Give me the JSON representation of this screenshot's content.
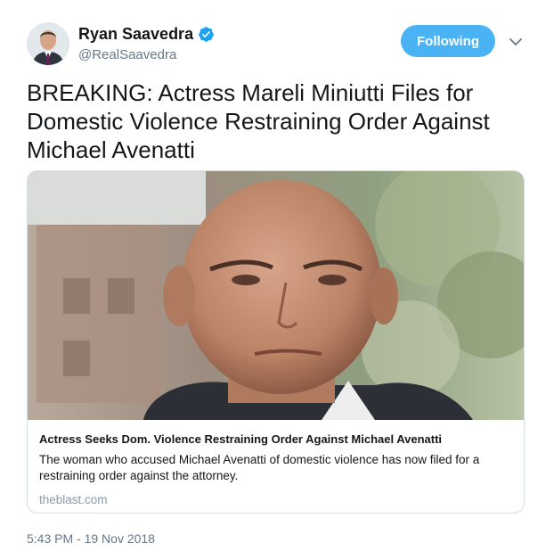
{
  "user": {
    "display_name": "Ryan Saavedra",
    "handle": "@RealSaavedra",
    "verified": true
  },
  "follow_button": {
    "label": "Following"
  },
  "tweet": {
    "text": "BREAKING: Actress Mareli Miniutti Files for Domestic Violence Restraining Order Against Michael Avenatti"
  },
  "card": {
    "title": "Actress Seeks Dom. Violence Restraining Order Against Michael Avenatti",
    "description": "The woman who accused Michael Avenatti of domestic violence has now filed for a restraining order against the attorney.",
    "domain": "theblast.com"
  },
  "timestamp": "5:43 PM - 19 Nov 2018",
  "colors": {
    "accent": "#4ab3f4",
    "verified": "#1da1f2",
    "secondary_text": "#657786"
  },
  "icons": [
    "verified-badge-icon",
    "chevron-down-icon"
  ]
}
